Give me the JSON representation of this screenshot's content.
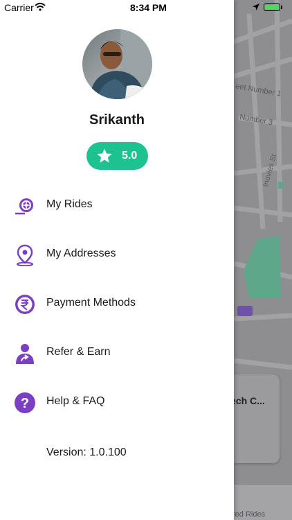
{
  "status_bar": {
    "carrier": "Carrier",
    "time": "8:34 PM"
  },
  "user": {
    "name": "Srikanth",
    "rating": "5.0"
  },
  "menu": [
    {
      "label": "My Rides",
      "icon": "rides-icon"
    },
    {
      "label": "My Addresses",
      "icon": "location-pin-icon"
    },
    {
      "label": "Payment Methods",
      "icon": "rupee-icon"
    },
    {
      "label": "Refer & Earn",
      "icon": "refer-icon"
    },
    {
      "label": "Help & FAQ",
      "icon": "help-icon"
    }
  ],
  "version": "Version: 1.0.100",
  "background": {
    "street_1": "eet Number 1",
    "street_2": "Number 3",
    "street_3": "Inovies St",
    "card_title": "ech C...",
    "tab_label": "red Rides"
  },
  "colors": {
    "accent": "#7b3fc4",
    "rating_bg": "#1cc28f",
    "map_bg": "#8e8e91"
  }
}
